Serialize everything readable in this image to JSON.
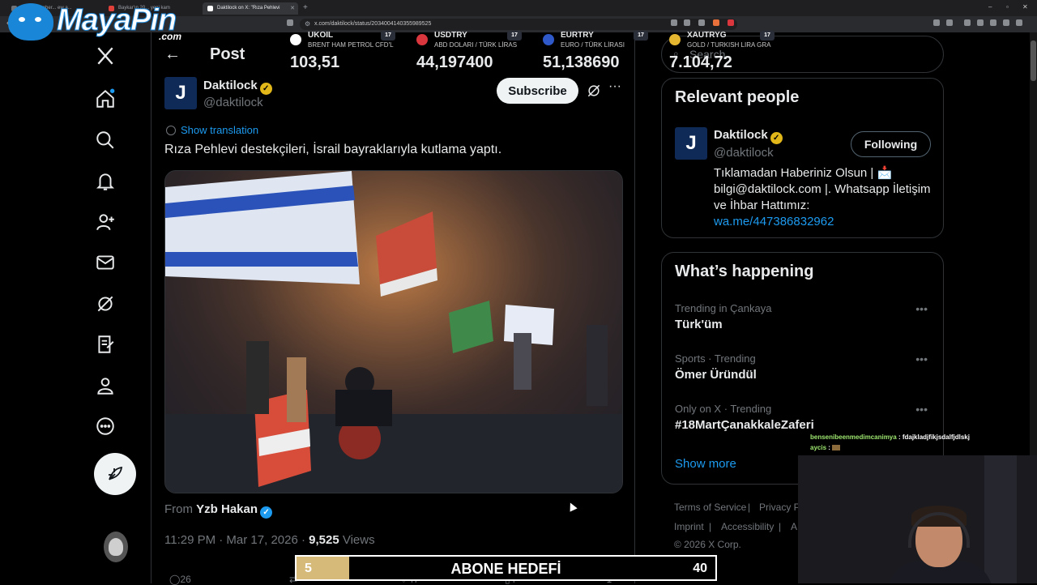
{
  "browser": {
    "tabs": [
      {
        "label": "Mu... 13 haber... ew a...",
        "color": "#6f7378"
      },
      {
        "label": "Baykar'ın 20... yeni kam",
        "color": "#e0403a"
      },
      {
        "label": "Daktilock on X: \"Rıza Pehlevi",
        "color": "#ffffff"
      }
    ],
    "url": "x.com/daktilock/status/2034004140355989525",
    "new_tab": "+",
    "minimize": "–",
    "restore": "▫",
    "close": "✕"
  },
  "logo": {
    "word": "MayaPin",
    "suffix": ".com"
  },
  "nav": {
    "icons": [
      "x-logo-icon",
      "home-icon",
      "search-icon",
      "notifications-icon",
      "follow-icon",
      "messages-icon",
      "grok-icon",
      "lists-icon",
      "profile-icon",
      "more-icon"
    ]
  },
  "post": {
    "header_title": "Post",
    "back": "←",
    "author_initial": "J",
    "author_name": "Daktilock",
    "author_handle": "@daktilock",
    "subscribe_label": "Subscribe",
    "more": "···",
    "show_translation": "Show translation",
    "text": "Rıza Pehlevi destekçileri, İsrail bayraklarıyla kutlama yaptı.",
    "from_prefix": "From ",
    "from_name": "Yzb Hakan",
    "time": "11:29 PM · Mar 17, 2026 · ",
    "views_count": "9,525",
    "views_label": " Views",
    "actions": [
      "26",
      "",
      "47",
      "4",
      ""
    ]
  },
  "ticker": [
    {
      "symbol": "UKOIL",
      "sub": "BRENT HAM PETROL CFD'L",
      "value": "103,51",
      "icon_color": "#ffffff",
      "tv": "17"
    },
    {
      "symbol": "USDTRY",
      "sub": "ABD DOLARI / TÜRK LİRAS",
      "value": "44,197400",
      "icon_color": "#d9363e",
      "tv": "17"
    },
    {
      "symbol": "EURTRY",
      "sub": "EURO / TÜRK LİRASI",
      "value": "51,138690",
      "icon_color": "#2f58c9",
      "tv": "17"
    },
    {
      "symbol": "XAUTRYG",
      "sub": "GOLD / TURKISH LIRA GRA",
      "value": "7.104,72",
      "icon_color": "#e5b730",
      "tv": "17"
    }
  ],
  "search": {
    "placeholder": "Search",
    "icon": "⌕"
  },
  "relevant": {
    "title": "Relevant people",
    "initial": "J",
    "name": "Daktilock",
    "handle": "@daktilock",
    "follow_label": "Following",
    "bio": "Tıklamadan Haberiniz Olsun | 📩 bilgi@daktilock.com |. Whatsapp İletişim ve İhbar Hattımız: ",
    "bio_link": "wa.me/447386832962"
  },
  "happening": {
    "title": "What’s happening",
    "trends": [
      {
        "context": "Trending in Çankaya",
        "topic": "Türk'üm"
      },
      {
        "context": "Sports · Trending",
        "topic": "Ömer Üründül"
      },
      {
        "context": "Only on X · Trending",
        "topic": "#18MartÇanakkaleZaferi"
      }
    ],
    "show_more": "Show more"
  },
  "footer": {
    "items": [
      "Terms of Service",
      "|",
      "Privacy P",
      "Imprint",
      "|",
      "Accessibility",
      "|",
      "A",
      "© 2026 X Corp."
    ]
  },
  "chat": [
    {
      "user": "bensenibeenmedimcanimya",
      "message": " : fdajkladjfikjsdalfjdlskj"
    },
    {
      "user": "aycis",
      "message": " : "
    }
  ],
  "goal": {
    "current": "5",
    "label": "ABONE HEDEFİ",
    "target": "40",
    "progress": 0.125
  },
  "colors": {
    "accent": "#1d9bf0",
    "verified_gold": "#e2b719",
    "verified_blue": "#1d9bf0",
    "goal_fill": "#d6ba7a"
  }
}
